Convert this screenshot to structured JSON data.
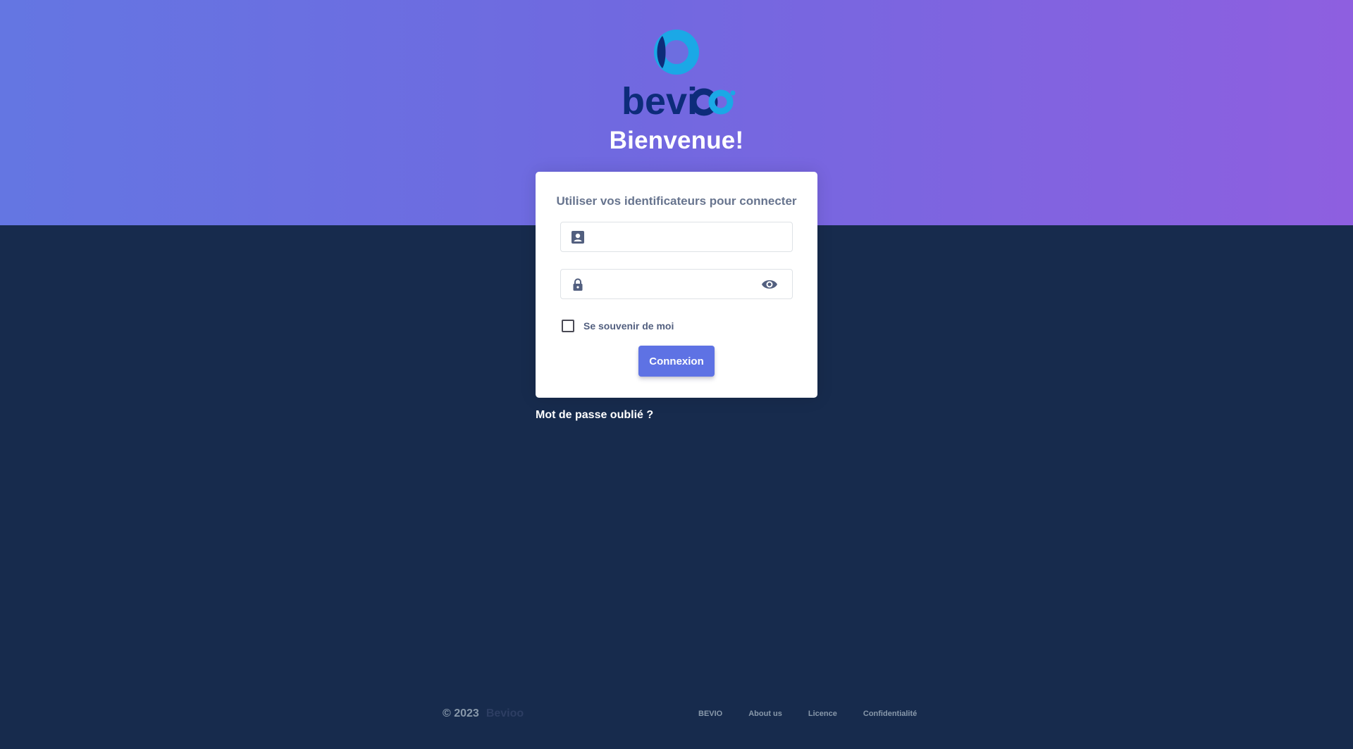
{
  "brand": {
    "logo_text": "bevioo",
    "colors": {
      "accent": "#5e72e4",
      "logo_blue": "#0d2c7a",
      "logo_cyan": "#1ba8e6",
      "background": "#172b4d"
    }
  },
  "hero": {
    "welcome": "Bienvenue!"
  },
  "login": {
    "title": "Utiliser vos identificateurs pour connecter",
    "username": {
      "icon": "user-card-icon",
      "value": "",
      "placeholder": ""
    },
    "password": {
      "icon": "lock-icon",
      "value": "",
      "placeholder": "",
      "toggle_icon": "eye-icon"
    },
    "remember_label": "Se souvenir de moi",
    "remember_checked": false,
    "submit_label": "Connexion"
  },
  "forgot_password": "Mot de passe oublié ?",
  "footer": {
    "copyright": "© 2023",
    "brand": "Bevioo",
    "links": [
      "BEVIO",
      "About us",
      "Licence",
      "Confidentialité"
    ]
  }
}
